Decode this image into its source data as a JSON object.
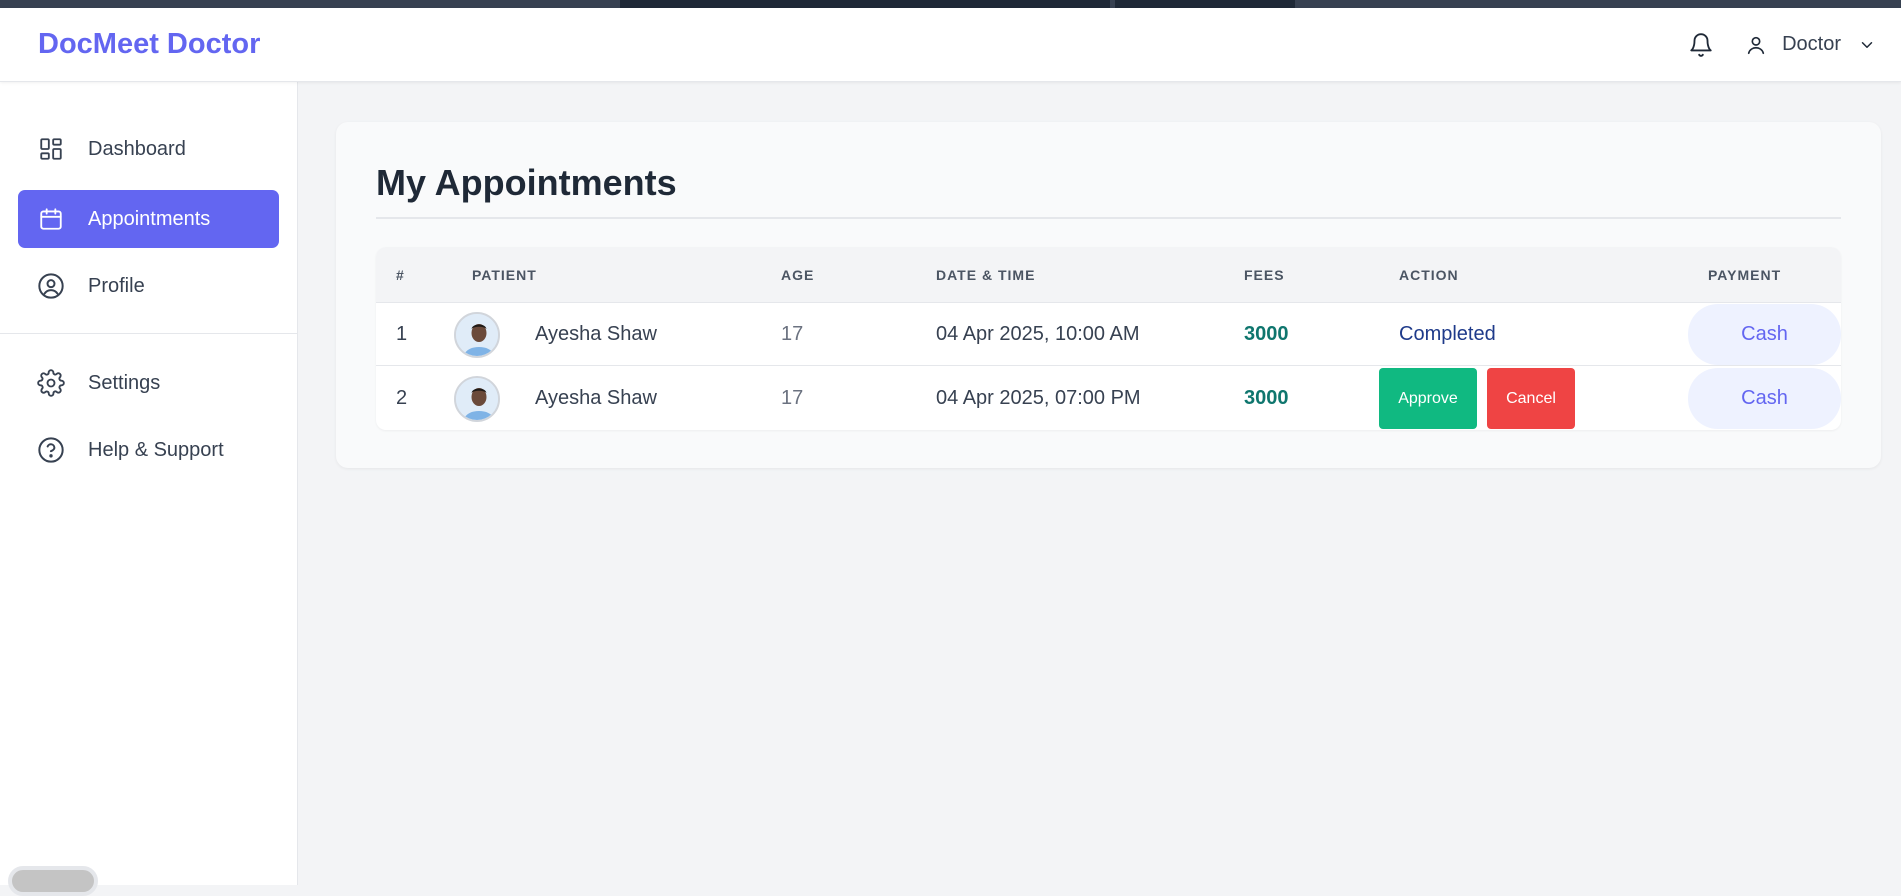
{
  "app": {
    "brand": "DocMeet Doctor",
    "accent_color": "#6366f1"
  },
  "header": {
    "user_label": "Doctor",
    "icons": [
      "bell-icon",
      "user-icon",
      "chevron-down-icon"
    ]
  },
  "sidebar": {
    "items": [
      {
        "label": "Dashboard",
        "icon": "dashboard-icon",
        "active": false
      },
      {
        "label": "Appointments",
        "icon": "calendar-icon",
        "active": true
      },
      {
        "label": "Profile",
        "icon": "user-circle-icon",
        "active": false
      },
      {
        "label": "Settings",
        "icon": "gear-icon",
        "active": false
      },
      {
        "label": "Help & Support",
        "icon": "help-circle-icon",
        "active": false
      }
    ]
  },
  "main": {
    "title": "My Appointments",
    "table": {
      "headers": [
        "#",
        "PATIENT",
        "AGE",
        "DATE & TIME",
        "FEES",
        "ACTION",
        "PAYMENT"
      ],
      "rows": [
        {
          "num": "1",
          "patient": "Ayesha Shaw",
          "age": "17",
          "datetime": "04 Apr 2025, 10:00 AM",
          "fees": "3000",
          "status": "Completed",
          "payment": "Cash"
        },
        {
          "num": "2",
          "patient": "Ayesha Shaw",
          "age": "17",
          "datetime": "04 Apr 2025, 07:00 PM",
          "fees": "3000",
          "approve": "Approve",
          "cancel": "Cancel",
          "payment": "Cash"
        }
      ]
    }
  },
  "colors": {
    "approve": "#10b981",
    "cancel": "#ef4444",
    "fees": "#0f766e",
    "completed": "#1e3a8a"
  }
}
